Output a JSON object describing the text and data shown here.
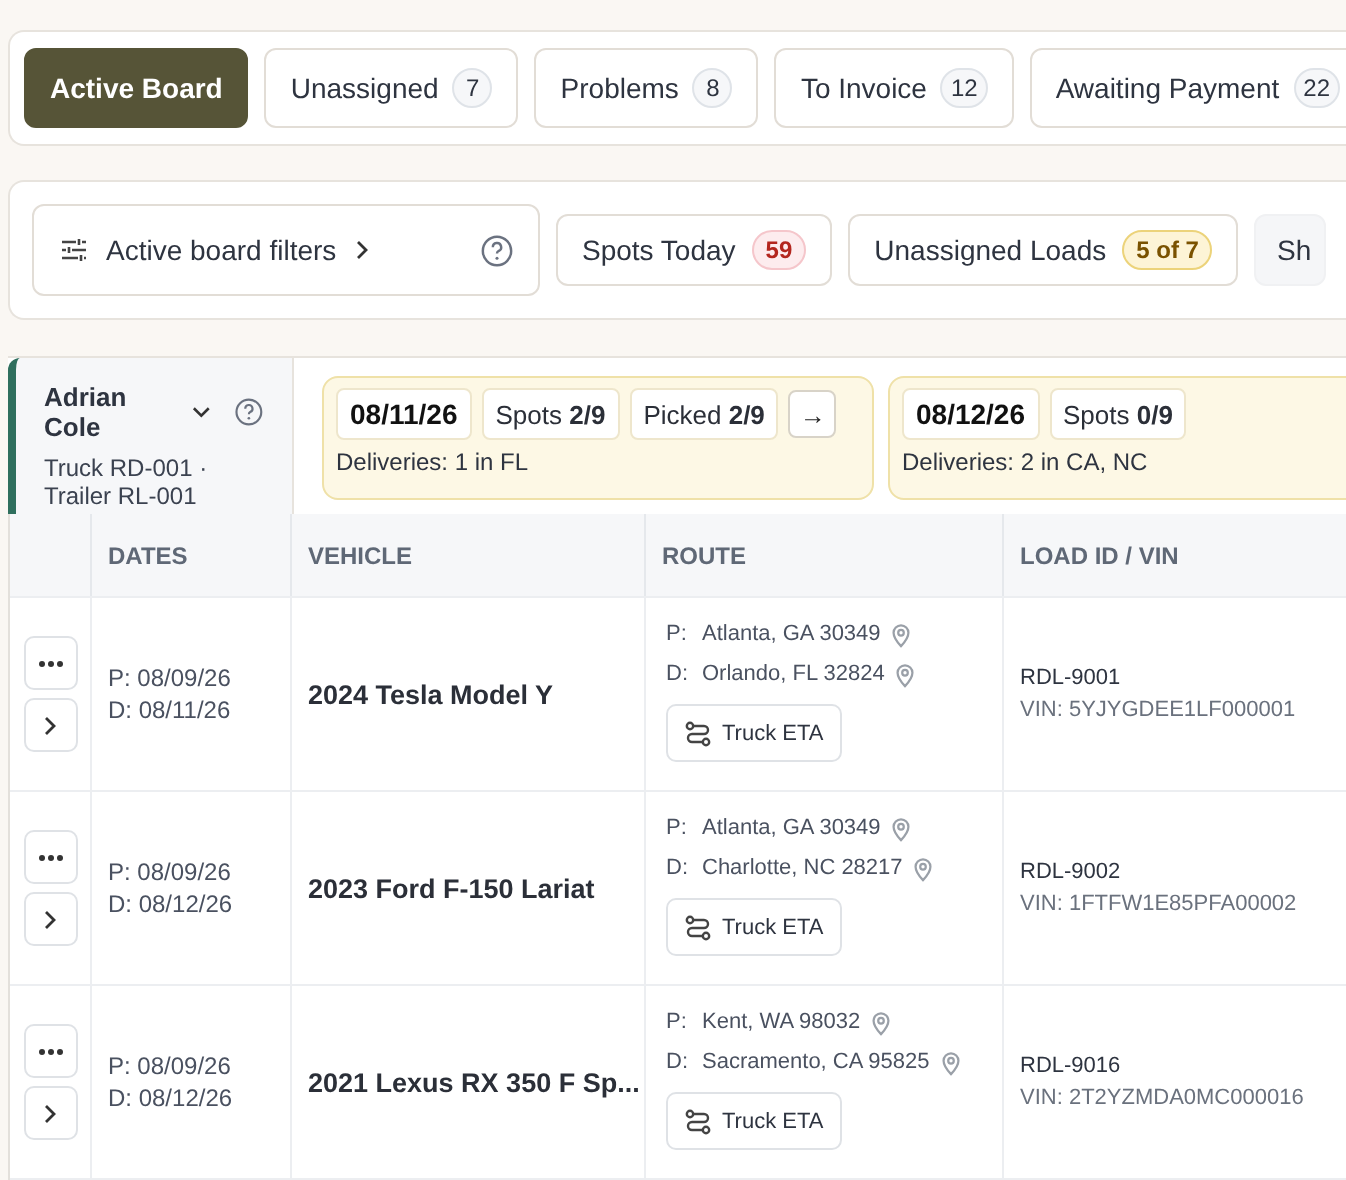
{
  "tabs": [
    {
      "label": "Active Board",
      "selected": true
    },
    {
      "label": "Unassigned",
      "count": "7",
      "selected": false
    },
    {
      "label": "Problems",
      "count": "8",
      "selected": false
    },
    {
      "label": "To Invoice",
      "count": "12",
      "selected": false
    },
    {
      "label": "Awaiting Payment",
      "count": "22",
      "selected": false
    }
  ],
  "toolbar": {
    "filters": "Active board filters",
    "chips": [
      {
        "kind": "alert",
        "label": "Spots Today",
        "badge": "59"
      },
      {
        "kind": "warning",
        "label": "Unassigned Loads",
        "badge": "5 of 7"
      },
      {
        "kind": "plain",
        "label": "Sh"
      }
    ]
  },
  "driver": {
    "name": "Adrian Cole",
    "equipment": "Truck RD-001 · Trailer RL-001"
  },
  "days": [
    {
      "date": "08/11/26",
      "stats": [
        {
          "label": "Spots",
          "value": "2/9"
        },
        {
          "label": "Picked",
          "value": "2/9"
        }
      ],
      "next": "→",
      "deliveries": "Deliveries: 1 in FL"
    },
    {
      "date": "08/12/26",
      "stats": [
        {
          "label": "Spots",
          "value": "0/9"
        }
      ],
      "deliveries": "Deliveries: 2 in CA, NC"
    }
  ],
  "table": {
    "columns": [
      "DATES",
      "VEHICLE",
      "ROUTE",
      "LOAD ID / VIN"
    ],
    "rows": [
      {
        "pickup": "P: 08/09/26",
        "delivery": "D: 08/11/26",
        "vehicle": "2024 Tesla Model Y",
        "route": [
          {
            "prefix": "P:",
            "place": "Atlanta, GA 30349"
          },
          {
            "prefix": "D:",
            "place": "Orlando, FL 32824"
          }
        ],
        "eta": "Truck ETA",
        "load_id": "RDL-9001",
        "vin": "VIN: 5YJYGDEE1LF000001"
      },
      {
        "pickup": "P: 08/09/26",
        "delivery": "D: 08/12/26",
        "vehicle": "2023 Ford F-150 Lariat",
        "route": [
          {
            "prefix": "P:",
            "place": "Atlanta, GA 30349"
          },
          {
            "prefix": "D:",
            "place": "Charlotte, NC 28217"
          }
        ],
        "eta": "Truck ETA",
        "load_id": "RDL-9002",
        "vin": "VIN: 1FTFW1E85PFA00002"
      },
      {
        "pickup": "P: 08/09/26",
        "delivery": "D: 08/12/26",
        "vehicle": "2021 Lexus RX 350 F Sp...",
        "route": [
          {
            "prefix": "P:",
            "place": "Kent, WA 98032"
          },
          {
            "prefix": "D:",
            "place": "Sacramento, CA 95825"
          }
        ],
        "eta": "Truck ETA",
        "load_id": "RDL-9016",
        "vin": "VIN: 2T2YZMDA0MC000016"
      }
    ]
  }
}
